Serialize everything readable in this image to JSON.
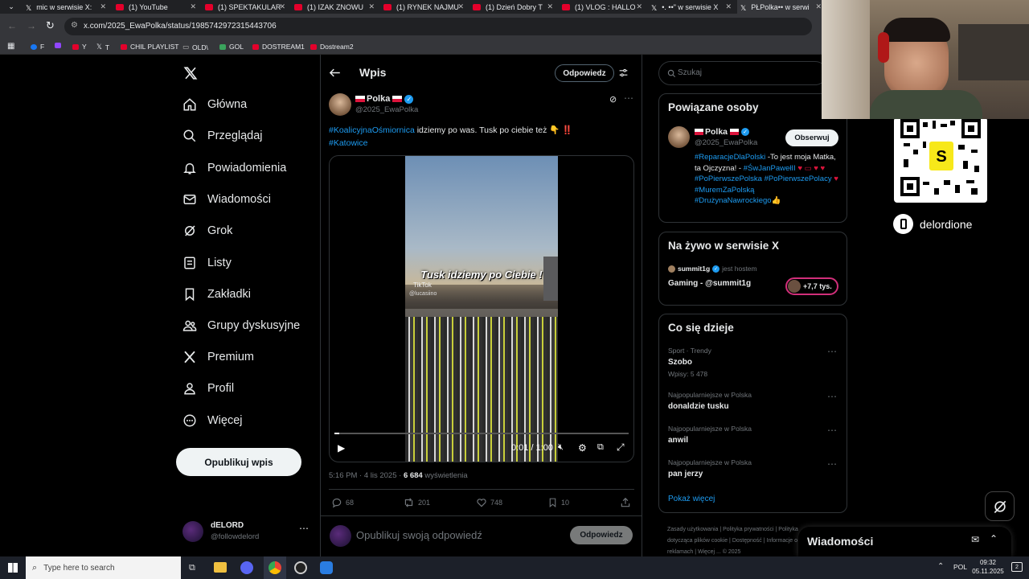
{
  "tabs": [
    {
      "label": "mic w serwisie X:"
    },
    {
      "label": "(1) YouTube"
    },
    {
      "label": "(1) SPEKTAKULAR"
    },
    {
      "label": "(1) IZAK ZNOWU"
    },
    {
      "label": "(1) RYNEK NAJMU"
    },
    {
      "label": "(1) Dzień Dobry T"
    },
    {
      "label": "(1) VLOG : HALLO"
    },
    {
      "label": "•. ••\" w serwisie X"
    },
    {
      "label": "PŁPolka•• w serwi"
    }
  ],
  "address": {
    "url": "x.com/2025_EwaPolka/status/1985742972315443706"
  },
  "bookmarks": [
    {
      "label": "F"
    },
    {
      "label": ""
    },
    {
      "label": "Y"
    },
    {
      "label": "T"
    },
    {
      "label": "CHIL PLAYLIST"
    },
    {
      "label": "OLD\\"
    },
    {
      "label": "GOL"
    },
    {
      "label": "DOSTREAM1"
    },
    {
      "label": "Dostream2"
    }
  ],
  "nav": {
    "items": [
      {
        "label": "Główna",
        "icon": "home-icon"
      },
      {
        "label": "Przeglądaj",
        "icon": "search-icon"
      },
      {
        "label": "Powiadomienia",
        "icon": "bell-icon"
      },
      {
        "label": "Wiadomości",
        "icon": "mail-icon"
      },
      {
        "label": "Grok",
        "icon": "grok-icon"
      },
      {
        "label": "Listy",
        "icon": "list-icon"
      },
      {
        "label": "Zakładki",
        "icon": "bookmark-icon"
      },
      {
        "label": "Grupy dyskusyjne",
        "icon": "people-icon"
      },
      {
        "label": "Premium",
        "icon": "x-logo-icon"
      },
      {
        "label": "Profil",
        "icon": "person-icon"
      },
      {
        "label": "Więcej",
        "icon": "more-circle-icon"
      }
    ],
    "publish": "Opublikuj wpis",
    "account": {
      "name": "dELORD",
      "handle": "@followdelord"
    }
  },
  "post": {
    "header_title": "Wpis",
    "reply_header_btn": "Odpowiedz",
    "author_name": "Polka",
    "author_handle": "@2025_EwaPolka",
    "hashtag1": "#KoalicyjnaOśmiornica",
    "text": " idziemy po was. Tusk po ciebie też 👇 ‼️",
    "hashtag2": "#Katowice",
    "video_caption": "Tusk idziemy po Ciebie !",
    "video_tiktok": "TikTok",
    "video_user": "@lucasiino",
    "video_time": "0:01 / 1:00",
    "video_progress": 0.017,
    "timestamp": "5:16 PM · 4 lis 2025 · ",
    "views_count": "6 684",
    "views_label": " wyświetlenia",
    "replies": "68",
    "reposts": "201",
    "likes": "748",
    "bookmarks": "10",
    "reply_placeholder": "Opublikuj swoją odpowiedź",
    "reply_button": "Odpowiedz"
  },
  "right": {
    "search_placeholder": "Szukaj",
    "related_title": "Powiązane osoby",
    "related_name": "Polka",
    "related_handle": "@2025_EwaPolka",
    "follow_button": "Obserwuj",
    "bio_tag1": "#ReparacjeDlaPolski",
    "bio_text1": " -To jest moja Matka, ta Ojczyzna! - ",
    "bio_tag2": "#ŚwJanPawełII",
    "bio_tag3": "#PoPierwszePolska",
    "bio_tag4": "#PoPierwszePolacy",
    "bio_tag5": "#MuremZaPolską",
    "bio_tag6": "#DrużynaNawrockiego",
    "live_title": "Na żywo w serwisie X",
    "live_host": "summit1g",
    "live_host_suffix": "jest hostem",
    "live_name": "Gaming - @summit1g",
    "live_count": "+7,7 tys.",
    "trends_title": "Co się dzieje",
    "trends": [
      {
        "meta": "Sport · Trendy",
        "name": "Szobo",
        "posts": "Wpisy: 5 478"
      },
      {
        "meta": "Najpopularniejsze w Polska",
        "name": "donaldzie tusku",
        "posts": ""
      },
      {
        "meta": "Najpopularniejsze w Polska",
        "name": "anwil",
        "posts": ""
      },
      {
        "meta": "Najpopularniejsze w Polska",
        "name": "pan jerzy",
        "posts": ""
      }
    ],
    "show_more": "Pokaż więcej",
    "footer": [
      "Zasady użytkowania",
      "Polityka prywatności",
      "Polityka dotycząca plików cookie",
      "Dostępność",
      "Informacje o reklamach",
      "Więcej ...",
      "© 2025"
    ],
    "messages_title": "Wiadomości"
  },
  "overlay": {
    "streamer_label": "delordione"
  },
  "taskbar": {
    "search_placeholder": "Type here to search",
    "lang": "POL",
    "time": "09:32",
    "date": "05.11.2025",
    "notif_count": "2"
  }
}
